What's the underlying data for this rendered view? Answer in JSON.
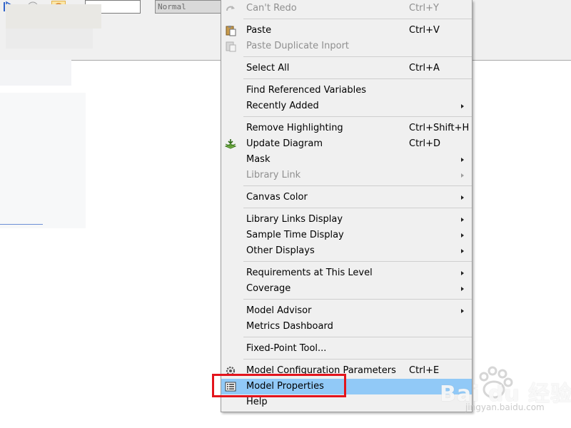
{
  "toolbar": {
    "simulation_mode": "Normal"
  },
  "menu": {
    "items": [
      {
        "label": "Can't Redo",
        "shortcut": "Ctrl+Y",
        "disabled": true,
        "icon": "redo-icon"
      },
      {
        "label": "Paste",
        "shortcut": "Ctrl+V",
        "disabled": false,
        "icon": "paste-icon"
      },
      {
        "label": "Paste Duplicate Inport",
        "shortcut": "",
        "disabled": true,
        "icon": "paste-duplicate-icon"
      },
      {
        "label": "Select All",
        "shortcut": "Ctrl+A",
        "disabled": false
      },
      {
        "label": "Find Referenced Variables",
        "shortcut": "",
        "disabled": false
      },
      {
        "label": "Recently Added",
        "shortcut": "",
        "disabled": false,
        "submenu": true
      },
      {
        "label": "Remove Highlighting",
        "shortcut": "Ctrl+Shift+H",
        "disabled": false
      },
      {
        "label": "Update Diagram",
        "shortcut": "Ctrl+D",
        "disabled": false,
        "icon": "update-diagram-icon"
      },
      {
        "label": "Mask",
        "shortcut": "",
        "disabled": false,
        "submenu": true
      },
      {
        "label": "Library Link",
        "shortcut": "",
        "disabled": true,
        "submenu": true
      },
      {
        "label": "Canvas Color",
        "shortcut": "",
        "disabled": false,
        "submenu": true
      },
      {
        "label": "Library Links Display",
        "shortcut": "",
        "disabled": false,
        "submenu": true
      },
      {
        "label": "Sample Time Display",
        "shortcut": "",
        "disabled": false,
        "submenu": true
      },
      {
        "label": "Other Displays",
        "shortcut": "",
        "disabled": false,
        "submenu": true
      },
      {
        "label": "Requirements at This Level",
        "shortcut": "",
        "disabled": false,
        "submenu": true
      },
      {
        "label": "Coverage",
        "shortcut": "",
        "disabled": false,
        "submenu": true
      },
      {
        "label": "Model Advisor",
        "shortcut": "",
        "disabled": false,
        "submenu": true
      },
      {
        "label": "Metrics Dashboard",
        "shortcut": "",
        "disabled": false
      },
      {
        "label": "Fixed-Point Tool...",
        "shortcut": "",
        "disabled": false
      },
      {
        "label": "Model Configuration Parameters",
        "shortcut": "Ctrl+E",
        "disabled": false,
        "icon": "gear-icon"
      },
      {
        "label": "Model Properties",
        "shortcut": "",
        "disabled": false,
        "highlighted": true,
        "icon": "properties-icon"
      },
      {
        "label": "Help",
        "shortcut": "",
        "disabled": false
      }
    ]
  },
  "annotation": {
    "color": "#e3141c",
    "target": "Model Properties"
  },
  "watermark": {
    "text": "Bai du 经验",
    "url": "jingyan.baidu.com"
  },
  "colors": {
    "menu_bg": "#f0f0f0",
    "highlight": "#91c9f7",
    "disabled_text": "#8f8f8f"
  }
}
